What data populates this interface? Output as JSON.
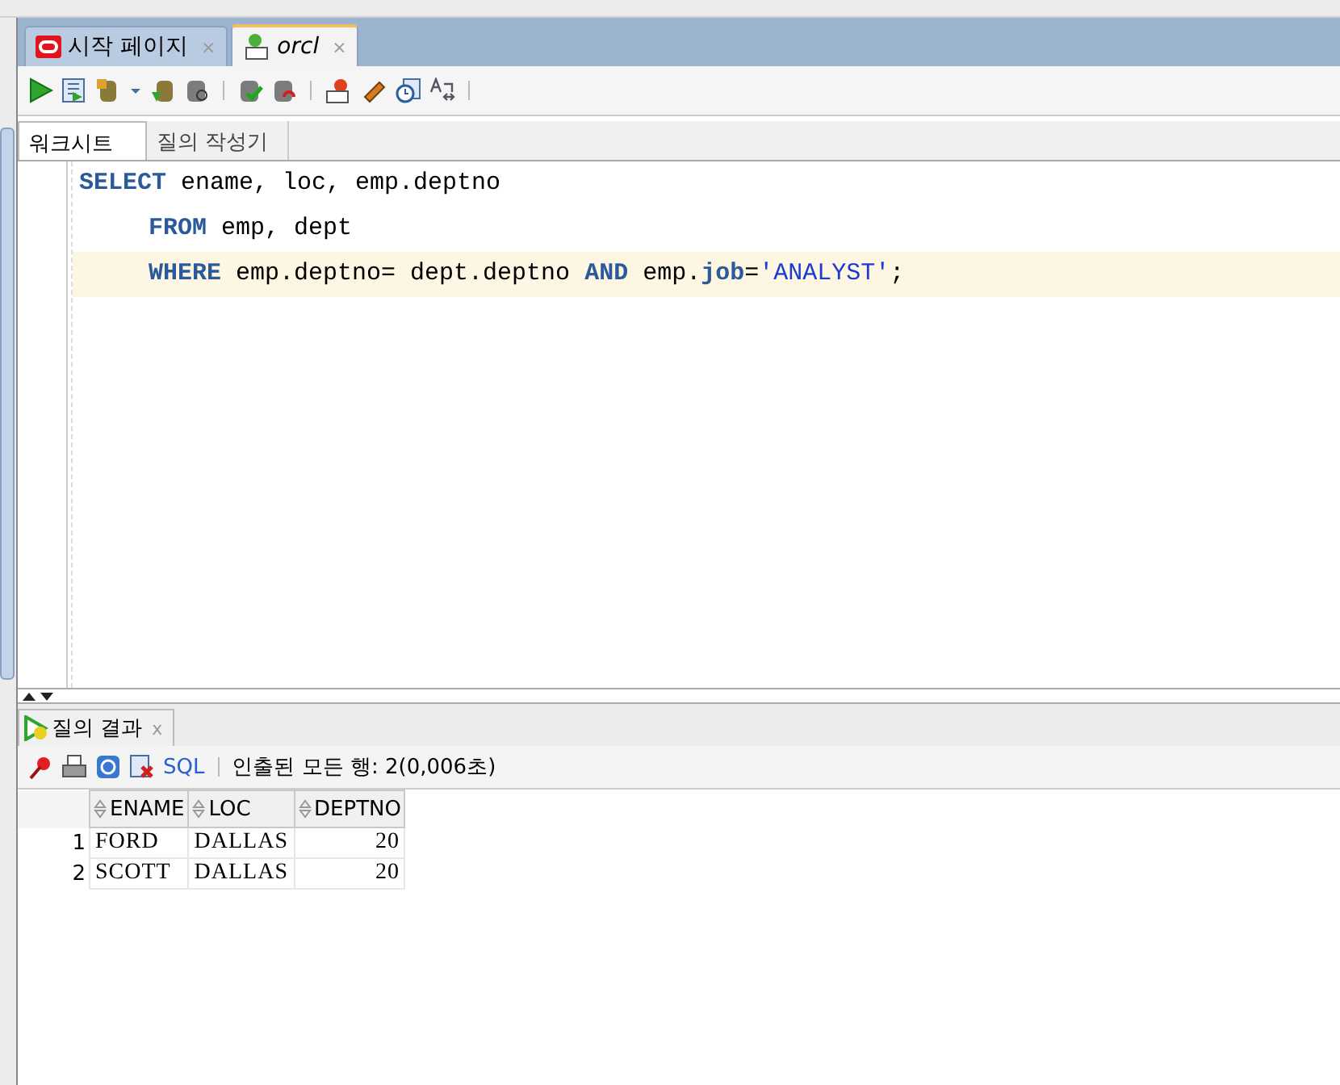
{
  "doc_tabs": [
    {
      "label": "시작 페이지",
      "close": "×",
      "italic": false,
      "selected": false
    },
    {
      "label": "orcl",
      "close": "×",
      "italic": true,
      "selected": true
    }
  ],
  "sub_tabs": [
    {
      "label": "워크시트",
      "selected": true
    },
    {
      "label": "질의 작성기",
      "selected": false
    }
  ],
  "code_lines": [
    {
      "current": false,
      "indent": false,
      "tokens": [
        {
          "kind": "kw",
          "text": "SELECT"
        },
        {
          "kind": "plain",
          "text": " ename, loc, emp.deptno"
        }
      ]
    },
    {
      "current": false,
      "indent": true,
      "tokens": [
        {
          "kind": "kw",
          "text": "FROM"
        },
        {
          "kind": "plain",
          "text": " emp, dept"
        }
      ]
    },
    {
      "current": true,
      "indent": true,
      "tokens": [
        {
          "kind": "kw",
          "text": "WHERE"
        },
        {
          "kind": "plain",
          "text": " emp.deptno= dept.deptno "
        },
        {
          "kind": "kw",
          "text": "AND"
        },
        {
          "kind": "plain",
          "text": " emp."
        },
        {
          "kind": "col",
          "text": "job"
        },
        {
          "kind": "plain",
          "text": "="
        },
        {
          "kind": "str",
          "text": "'ANALYST'"
        },
        {
          "kind": "plain",
          "text": ";"
        }
      ]
    }
  ],
  "results": {
    "tab": {
      "label": "질의 결과",
      "close": "x"
    },
    "sql_link": "SQL",
    "status": "인출된 모든 행: 2(0,006초)",
    "columns": [
      "ENAME",
      "LOC",
      "DEPTNO"
    ],
    "rows": [
      {
        "num": "1",
        "cells": [
          "FORD",
          "DALLAS",
          "20"
        ]
      },
      {
        "num": "2",
        "cells": [
          "SCOTT",
          "DALLAS",
          "20"
        ]
      }
    ]
  }
}
